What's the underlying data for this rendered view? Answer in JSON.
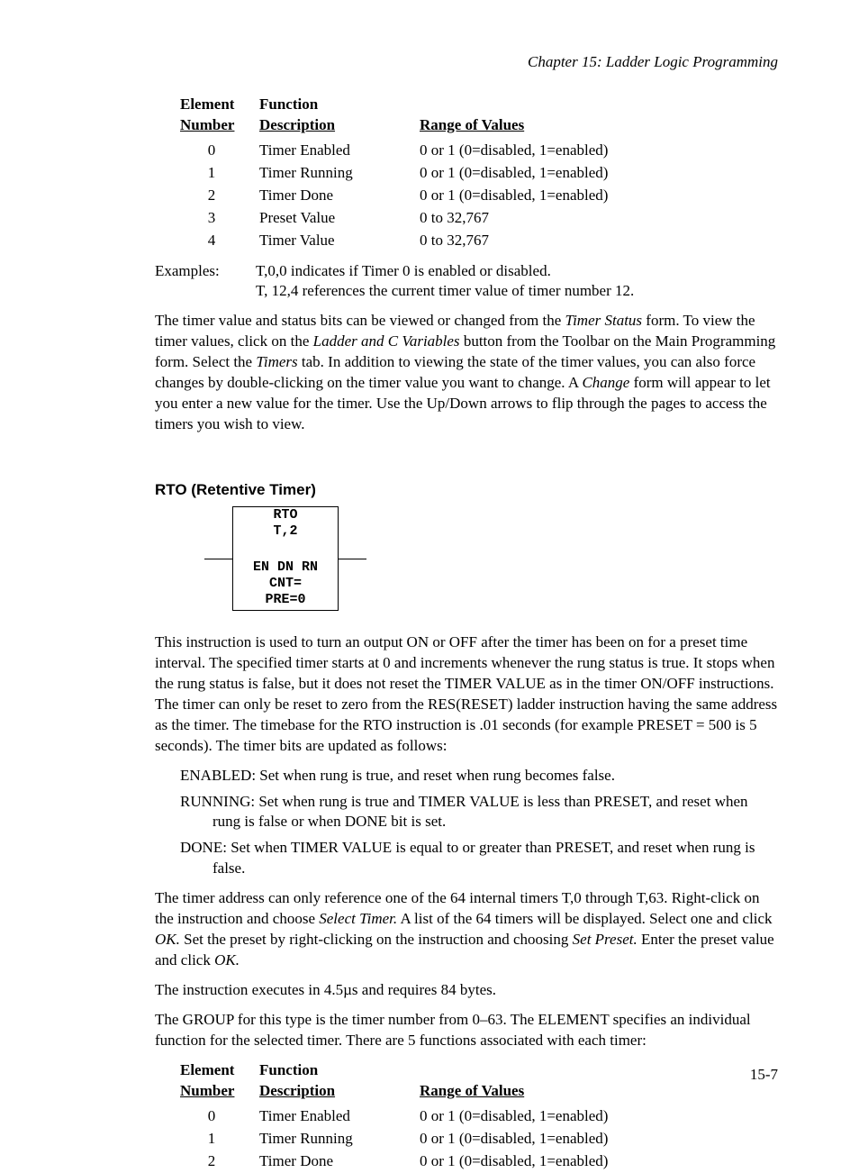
{
  "chapter_header": "Chapter 15: Ladder Logic Programming",
  "table1": {
    "h1a": "Element",
    "h1b": "Number",
    "h2a": "Function",
    "h2b": "Description",
    "h3": "Range of Values",
    "rows": [
      {
        "n": "0",
        "d": "Timer Enabled",
        "r": "0 or 1 (0=disabled, 1=enabled)"
      },
      {
        "n": "1",
        "d": "Timer Running",
        "r": "0 or 1 (0=disabled, 1=enabled)"
      },
      {
        "n": "2",
        "d": "Timer Done",
        "r": "0 or 1 (0=disabled, 1=enabled)"
      },
      {
        "n": "3",
        "d": "Preset Value",
        "r": "0 to 32,767"
      },
      {
        "n": "4",
        "d": "Timer Value",
        "r": "0 to 32,767"
      }
    ]
  },
  "examples_label": "Examples:",
  "examples_line1": "T,0,0  indicates if Timer 0 is enabled or disabled.",
  "examples_line2": "T, 12,4  references the current timer value of timer number 12.",
  "para1_a": "The timer value and status bits can be viewed or changed from the ",
  "para1_i1": "Timer Status",
  "para1_b": " form.  To view the timer values, click on the ",
  "para1_i2": "Ladder and C Variables",
  "para1_c": " button from the Toolbar on the Main Programming form.  Select the ",
  "para1_i3": "Timers",
  "para1_d": " tab.  In addition to viewing the state of the timer values, you can also force changes by double-clicking on the timer value you want to change.  A ",
  "para1_i4": "Change",
  "para1_e": " form will appear to let you enter a new value for the timer.  Use the Up/Down arrows to flip through the pages to access the timers you wish to view.",
  "section_head": "RTO   (Retentive Timer)",
  "rto": {
    "l1": "RTO",
    "l2": "T,2",
    "l3": "EN  DN  RN",
    "l4": "CNT=",
    "l5": "PRE=0"
  },
  "para2": "This instruction is used to turn an output ON or OFF after the timer has been on for a preset time interval. The specified timer starts at 0 and increments whenever  the rung status is true. It stops when the rung status is false, but it does not reset the TIMER VALUE as in the timer ON/OFF instructions. The timer can only be reset to zero from the RES(RESET) ladder instruction having the same address as the timer. The timebase for the RTO instruction is .01 seconds  (for example PRESET = 500 is 5 seconds).  The timer bits are updated as follows:",
  "bits": {
    "enabled": "ENABLED:  Set when rung is true, and reset when rung becomes false.",
    "running": "RUNNING:  Set when rung is true and TIMER VALUE is less than PRESET, and reset when rung is false or when DONE bit is set.",
    "done": " DONE:  Set when TIMER VALUE is equal to or greater than PRESET, and reset when rung is false."
  },
  "para3_a": "The timer address can only reference one of the 64 internal timers T,0 through T,63.  Right-click on the instruction and choose ",
  "para3_i1": "Select Timer.",
  "para3_b": "  A list of the 64 timers will be displayed.  Select one and click ",
  "para3_i2": "OK.",
  "para3_c": "  Set the preset by right-clicking on the instruction and choosing ",
  "para3_i3": "Set Preset.",
  "para3_d": "  Enter the preset value and click ",
  "para3_i4": "OK.",
  "para4": "The instruction executes in 4.5µs and requires 84 bytes.",
  "para5": "The GROUP for this type is the timer number from 0–63.  The ELEMENT specifies an individual function for the selected timer.  There are 5 functions associated with each timer:",
  "table2": {
    "h1a": "Element",
    "h1b": "Number",
    "h2a": "Function",
    "h2b": "Description",
    "h3": "Range of Values",
    "rows": [
      {
        "n": "0",
        "d": "Timer Enabled",
        "r": "0 or 1 (0=disabled, 1=enabled)"
      },
      {
        "n": "1",
        "d": "Timer Running",
        "r": "0 or 1 (0=disabled, 1=enabled)"
      },
      {
        "n": "2",
        "d": "Timer Done",
        "r": "0 or 1 (0=disabled, 1=enabled)"
      }
    ]
  },
  "page_num": "15-7"
}
